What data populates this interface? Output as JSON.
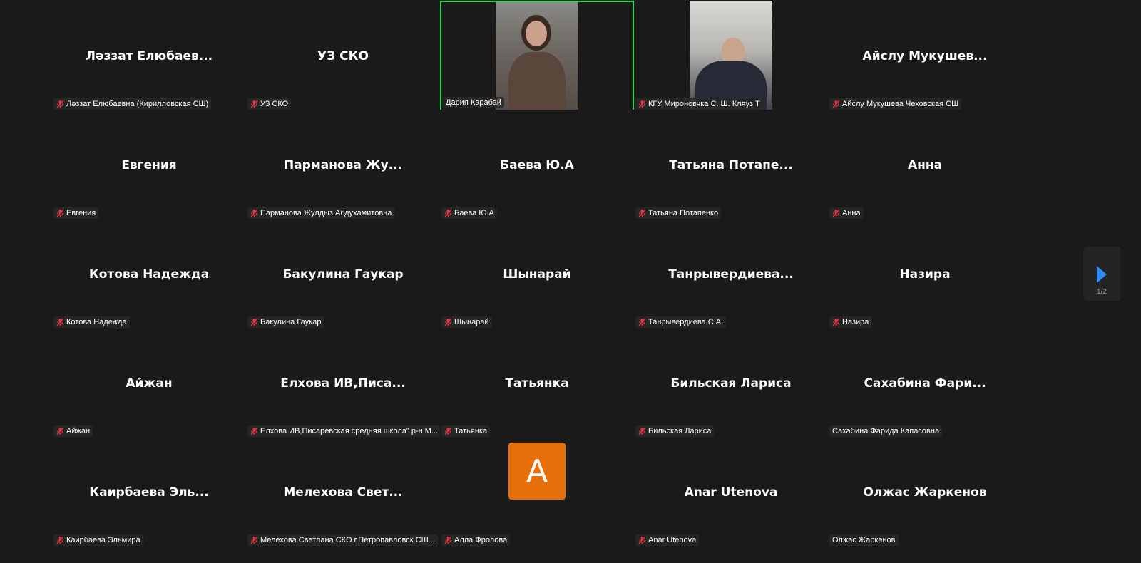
{
  "window": {
    "page": "1/2"
  },
  "colors": {
    "active_border": "#23d959",
    "mute_red": "#e0353e",
    "avatar_orange": "#e66f0a",
    "next_arrow": "#2d8cff"
  },
  "tiles": [
    {
      "big": "Ләззат Елюбаев...",
      "label": "Ләззат Елюбаевна (Кирилловская СШ)"
    },
    {
      "big": "УЗ СКО",
      "label": "УЗ СКО"
    },
    {
      "big": "",
      "label": "Дария Карабай"
    },
    {
      "big": "",
      "label": "КГУ Мироновчка С. Ш. Кляуз Т"
    },
    {
      "big": "Айслу Мукушев...",
      "label": "Айслу Мукушева Чеховская СШ"
    },
    {
      "big": "Евгения",
      "label": "Евгения"
    },
    {
      "big": "Парманова Жу...",
      "label": "Парманова Жулдыз Абдухамитовна"
    },
    {
      "big": "Баева Ю.А",
      "label": "Баева Ю.А"
    },
    {
      "big": "Татьяна Потапе...",
      "label": "Татьяна Потапенко"
    },
    {
      "big": "Анна",
      "label": "Анна"
    },
    {
      "big": "Котова Надежда",
      "label": "Котова Надежда"
    },
    {
      "big": "Бакулина Гаукар",
      "label": "Бакулина Гаукар"
    },
    {
      "big": "Шынарай",
      "label": "Шынарай"
    },
    {
      "big": "Танрывердиева...",
      "label": "Танрывердиева С.А."
    },
    {
      "big": "Назира",
      "label": "Назира"
    },
    {
      "big": "Айжан",
      "label": "Айжан"
    },
    {
      "big": "Елхова ИВ,Писа...",
      "label": "Елхова ИВ,Писаревская средняя школа\" р-н М..."
    },
    {
      "big": "Татьянка",
      "label": "Татьянка"
    },
    {
      "big": "Бильская Лариса",
      "label": "Бильская Лариса"
    },
    {
      "big": "Сахабина Фари...",
      "label": "Сахабина Фарида Капасовна"
    },
    {
      "big": "Каирбаева Эль...",
      "label": "Каирбаева Эльмира"
    },
    {
      "big": "Мелехова Свет...",
      "label": "Мелехова Светлана СКО г.Петропавловск СШ..."
    },
    {
      "big": "",
      "label": "Алла Фролова",
      "avatar": "А"
    },
    {
      "big": "Anar Utenova",
      "label": "Anar Utenova"
    },
    {
      "big": "Олжас Жаркенов",
      "label": "Олжас Жаркенов"
    }
  ]
}
